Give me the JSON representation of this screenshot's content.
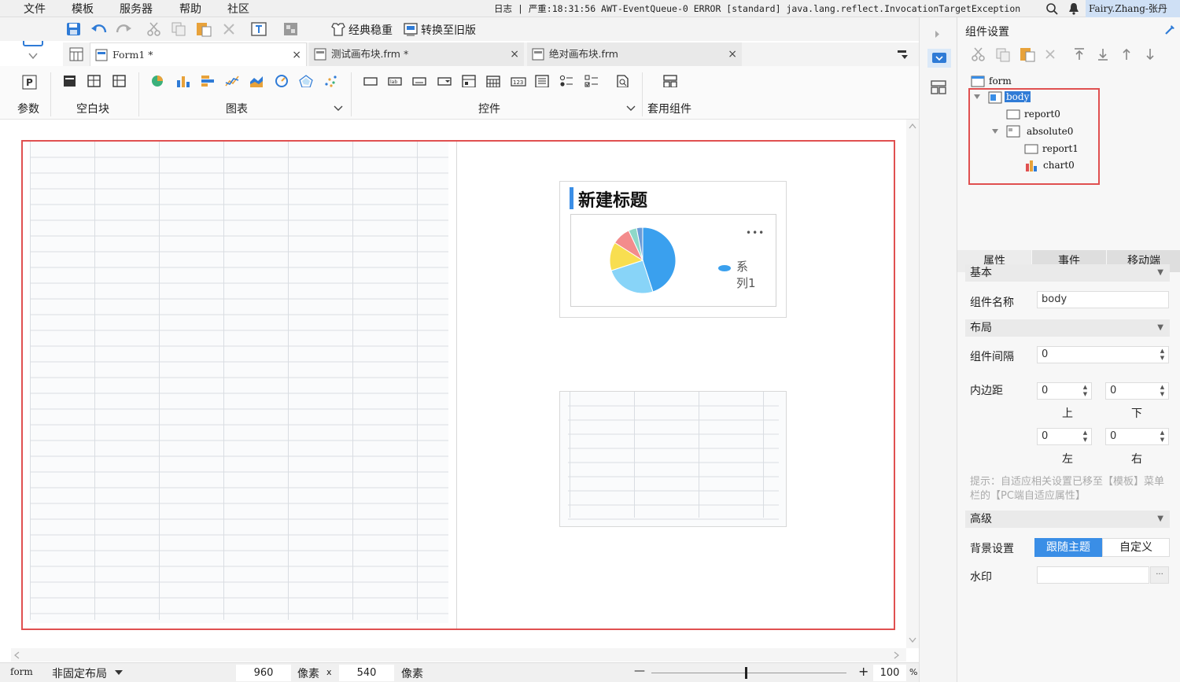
{
  "menu": [
    "文件",
    "模板",
    "服务器",
    "帮助",
    "社区"
  ],
  "status": {
    "log_label": "日志",
    "separator": "|",
    "message": "严重:18:31:56 AWT-EventQueue-0 ERROR [standard] java.lang.reflect.InvocationTargetException",
    "user": "Fairy.Zhang-张丹"
  },
  "toolbar": {
    "classic_label": "经典稳重",
    "convert_label": "转换至旧版"
  },
  "tabs": [
    {
      "label": "Form1 *",
      "close": "×"
    },
    {
      "label": "测试画布块.frm *",
      "close": "×"
    },
    {
      "label": "绝对画布块.frm",
      "close": "×"
    }
  ],
  "ribbon": {
    "param": "参数",
    "blank": "空白块",
    "chart": "图表",
    "control": "控件",
    "apply": "套用组件"
  },
  "chart_widget": {
    "title": "新建标题",
    "more": "•••",
    "legend": "系列1"
  },
  "chart_data": {
    "type": "pie",
    "title": "新建标题",
    "series": [
      {
        "name": "系列1",
        "values": [
          45,
          25,
          14,
          9,
          4,
          3
        ]
      }
    ],
    "colors": [
      "#3aa0ee",
      "#88d4f8",
      "#f8de50",
      "#f38c8c",
      "#8ed8c8",
      "#6c9cd8"
    ]
  },
  "bottom": {
    "layout_name": "form",
    "layout_mode": "非固定布局",
    "width": "960",
    "unit1": "像素",
    "x": "x",
    "height": "540",
    "unit2": "像素",
    "zoom": "100",
    "zoom_unit": "%",
    "minus": "—",
    "plus": "+"
  },
  "panel": {
    "title": "组件设置",
    "tree": {
      "form": "form",
      "body": "body",
      "report0": "report0",
      "absolute0": "absolute0",
      "report1": "report1",
      "chart0": "chart0"
    },
    "tabs": [
      "属性",
      "事件",
      "移动端"
    ],
    "basic": "基本",
    "name_label": "组件名称",
    "name_value": "body",
    "layout": "布局",
    "gap_label": "组件间隔",
    "gap_value": "0",
    "padding_label": "内边距",
    "pad": {
      "top": "0",
      "bottom": "0",
      "left": "0",
      "right": "0",
      "top_label": "上",
      "bottom_label": "下",
      "left_label": "左",
      "right_label": "右"
    },
    "hint": "提示：自适应相关设置已移至【模板】菜单栏的【PC端自适应属性】",
    "advanced": "高级",
    "bg_label": "背景设置",
    "bg_theme": "跟随主题",
    "bg_custom": "自定义",
    "watermark_label": "水印",
    "watermark_btn": "···"
  }
}
